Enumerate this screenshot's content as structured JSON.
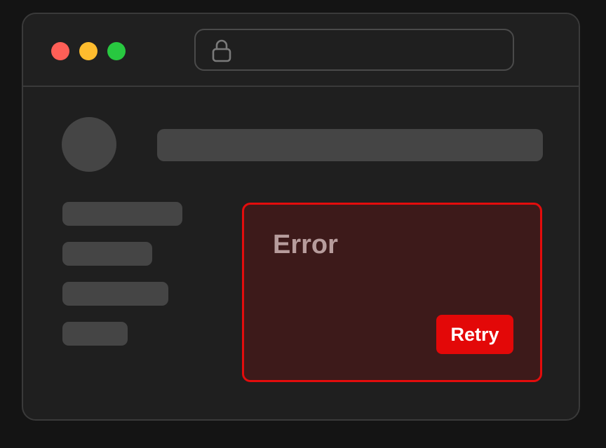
{
  "window": {
    "traffic_lights": {
      "close_color": "#ff5f57",
      "minimize_color": "#febc2e",
      "maximize_color": "#28c840"
    },
    "address_bar": {
      "icon": "lock-icon",
      "value": ""
    }
  },
  "error_card": {
    "title": "Error",
    "retry_label": "Retry",
    "accent_color": "#e30c0c",
    "background_color": "#3d1a1a"
  }
}
